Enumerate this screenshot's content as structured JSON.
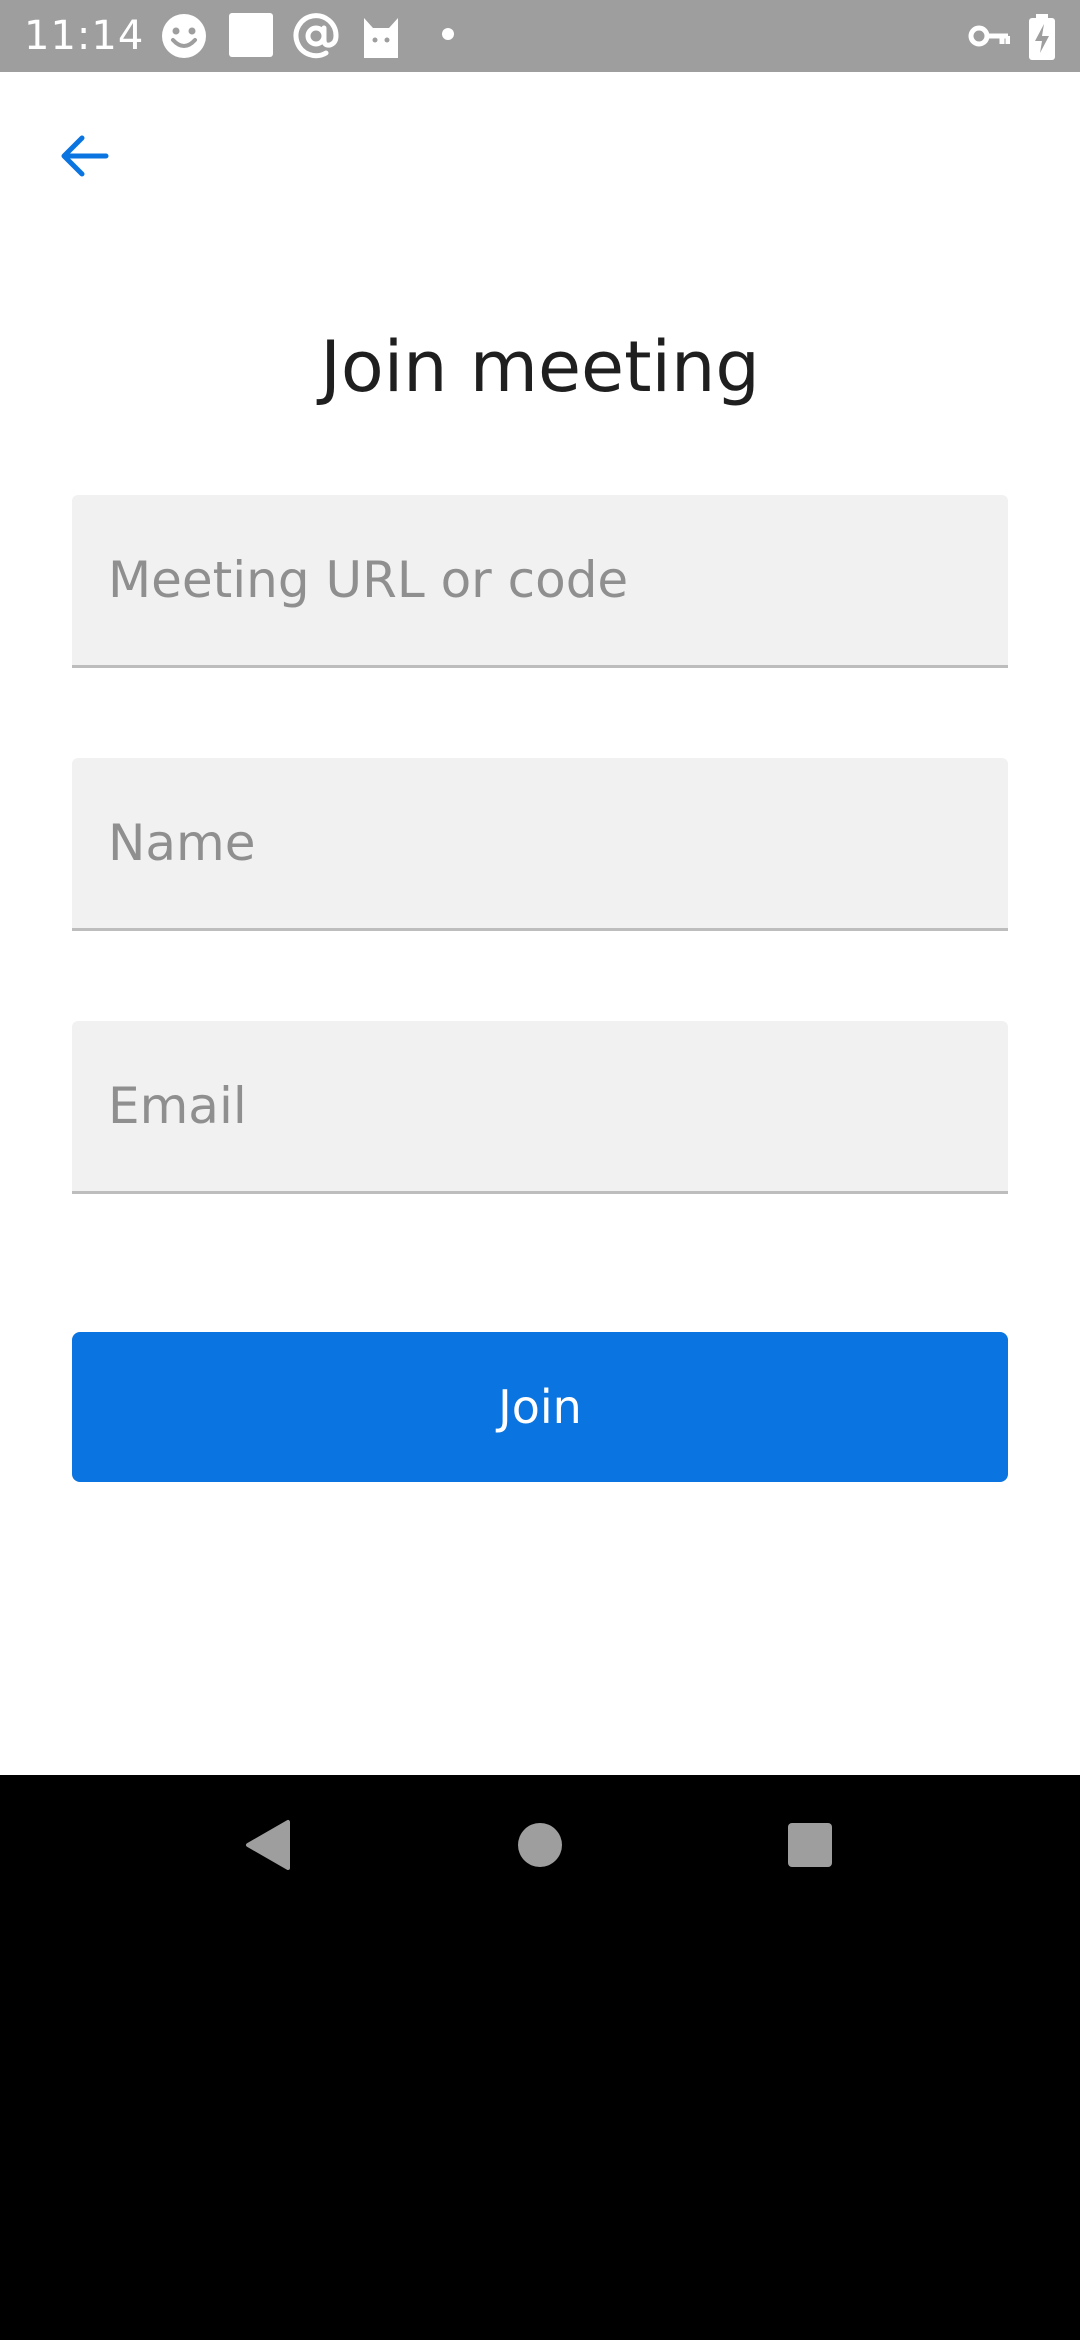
{
  "status_bar": {
    "time": "11:14",
    "icons": [
      "smiley-icon",
      "white-square-icon",
      "at-sign-icon",
      "cat-icon",
      "dot-icon",
      "vpn-key-icon",
      "battery-charging-icon"
    ]
  },
  "header": {
    "back_icon": "arrow-left-icon",
    "title": "Join meeting"
  },
  "form": {
    "meeting_field": {
      "placeholder": "Meeting URL or code",
      "value": ""
    },
    "name_field": {
      "placeholder": "Name",
      "value": ""
    },
    "email_field": {
      "placeholder": "Email",
      "value": ""
    },
    "join_label": "Join"
  },
  "nav_bar": {
    "icons": [
      "back-triangle-icon",
      "home-circle-icon",
      "recents-square-icon"
    ]
  },
  "colors": {
    "accent": "#0a74e0",
    "status_bar": "#9e9e9e",
    "field_background": "#f1f1f1",
    "placeholder_text": "#8f8f8f",
    "nav_icons": "#9e9e9e"
  }
}
